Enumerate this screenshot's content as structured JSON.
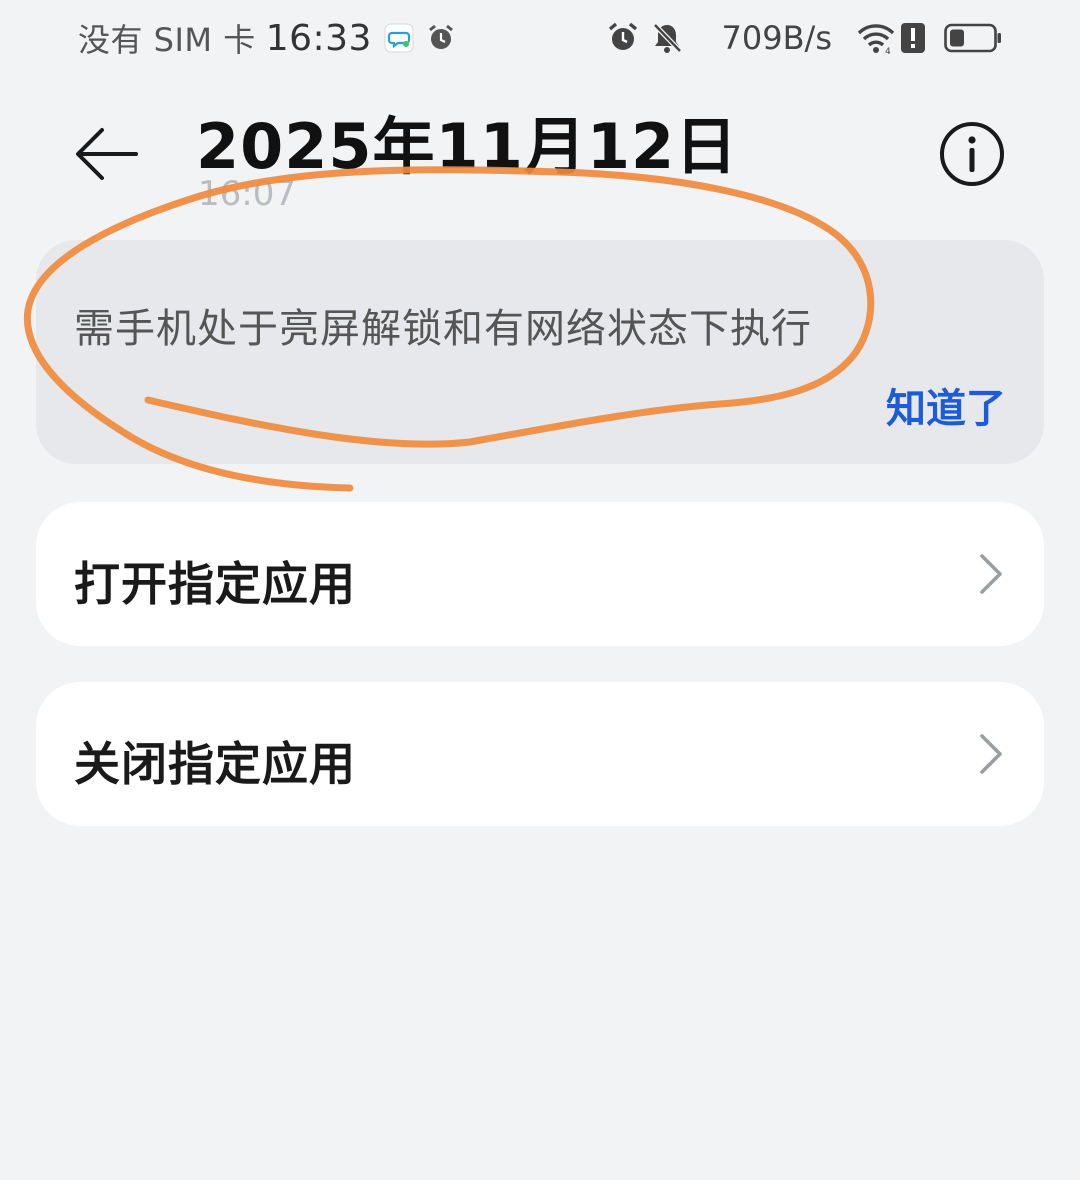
{
  "status_bar": {
    "carrier": "没有 SIM 卡",
    "time": "16:33",
    "network_speed": "709B/s",
    "icons": [
      "message-icon",
      "alarm-icon",
      "alarm-icon",
      "mute-bell-icon",
      "wifi-icon",
      "alert-icon",
      "battery-icon"
    ]
  },
  "header": {
    "title": "2025年11月12日",
    "subtitle": "16:07",
    "back_icon": "back-arrow-icon",
    "info_icon": "info-icon"
  },
  "notice": {
    "text": "需手机处于亮屏解锁和有网络状态下执行",
    "confirm_label": "知道了"
  },
  "actions": [
    {
      "label": "打开指定应用",
      "icon": "chevron-right-icon"
    },
    {
      "label": "关闭指定应用",
      "icon": "chevron-right-icon"
    }
  ],
  "colors": {
    "accent": "#1e5bd6",
    "background": "#f1f3f5",
    "notice_bg": "#e6e8eb",
    "card_bg": "#ffffff",
    "annotation": "#f08a3c"
  }
}
